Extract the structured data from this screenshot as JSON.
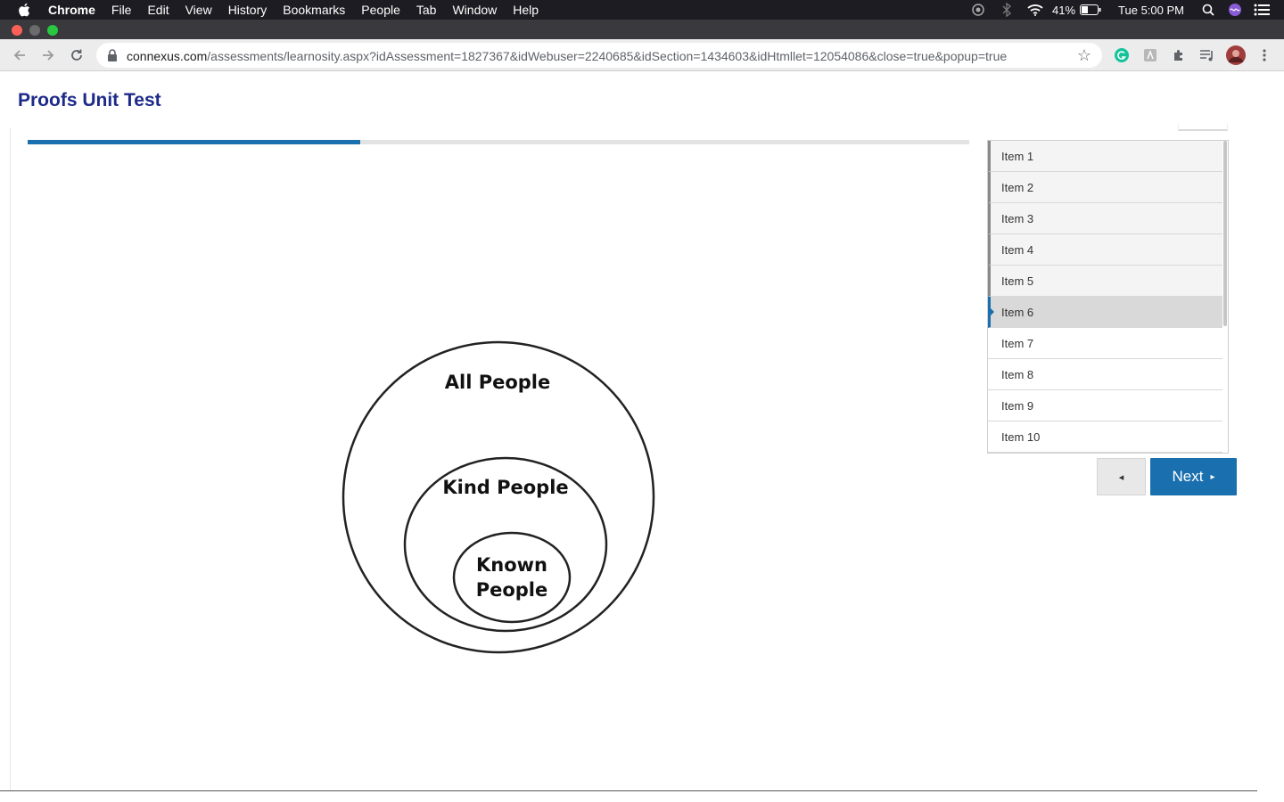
{
  "menubar": {
    "app": "Chrome",
    "menus": [
      "File",
      "Edit",
      "View",
      "History",
      "Bookmarks",
      "People",
      "Tab",
      "Window",
      "Help"
    ],
    "battery": "41%",
    "clock": "Tue 5:00 PM"
  },
  "browser": {
    "url_host": "connexus.com",
    "url_path": "/assessments/learnosity.aspx?idAssessment=1827367&idWebuser=2240685&idSection=1434603&idHtmllet=12054086&close=true&popup=true"
  },
  "page": {
    "title": "Proofs Unit Test",
    "progress_fraction": 0.353
  },
  "diagram": {
    "outer_label": "All People",
    "middle_label": "Kind People",
    "inner_label_line1": "Known",
    "inner_label_line2": "People"
  },
  "item_nav": {
    "items": [
      {
        "label": "Item 1",
        "state": "visited"
      },
      {
        "label": "Item 2",
        "state": "visited"
      },
      {
        "label": "Item 3",
        "state": "visited"
      },
      {
        "label": "Item 4",
        "state": "visited"
      },
      {
        "label": "Item 5",
        "state": "visited"
      },
      {
        "label": "Item 6",
        "state": "current"
      },
      {
        "label": "Item 7",
        "state": "unvisited"
      },
      {
        "label": "Item 8",
        "state": "unvisited"
      },
      {
        "label": "Item 9",
        "state": "unvisited"
      },
      {
        "label": "Item 10",
        "state": "unvisited"
      }
    ],
    "prev_label": "◂",
    "next_label": "Next",
    "next_arrow": "▸"
  },
  "colors": {
    "title": "#1d2a8a",
    "accent": "#1a6fae"
  }
}
